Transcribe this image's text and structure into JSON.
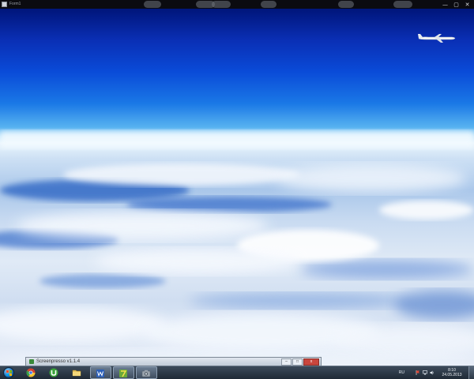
{
  "window": {
    "title": "Form1",
    "controls": {
      "minimize": "—",
      "maximize": "▢",
      "close": "✕"
    }
  },
  "scene": {
    "description_icons": [
      "airplane-icon"
    ]
  },
  "floating_window": {
    "title": "Screenpresso v1.1.4",
    "controls": {
      "minimize": "–",
      "maximize": "□",
      "close": "x"
    }
  },
  "taskbar": {
    "start": "start-orb-icon",
    "pinned": [
      {
        "name": "chrome",
        "icon": "chrome-icon",
        "color": "#d9412f"
      },
      {
        "name": "utorrent",
        "icon": "utorrent-icon",
        "color": "#3aa33a"
      },
      {
        "name": "explorer",
        "icon": "folder-icon",
        "color": "#e8c25a"
      },
      {
        "name": "word",
        "icon": "word-icon",
        "color": "#2b5fb8"
      },
      {
        "name": "app",
        "icon": "app-icon",
        "color": "#6aa83a"
      },
      {
        "name": "screenpresso",
        "icon": "camera-icon",
        "color": "#9aa4ae"
      }
    ],
    "tray": {
      "language": "RU",
      "icons": [
        "flag-icon",
        "network-icon",
        "volume-icon"
      ],
      "time": "8:10",
      "date": "24.05.2013"
    }
  }
}
